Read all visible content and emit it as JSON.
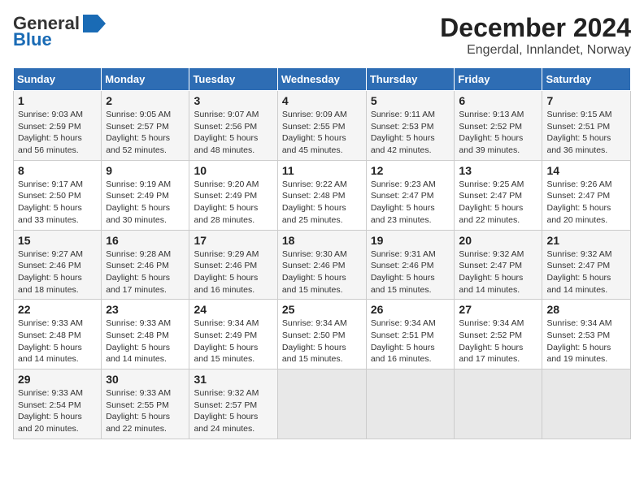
{
  "header": {
    "logo_line1": "General",
    "logo_line2": "Blue",
    "title": "December 2024",
    "subtitle": "Engerdal, Innlandet, Norway"
  },
  "calendar": {
    "weekdays": [
      "Sunday",
      "Monday",
      "Tuesday",
      "Wednesday",
      "Thursday",
      "Friday",
      "Saturday"
    ],
    "weeks": [
      [
        {
          "day": "1",
          "info": "Sunrise: 9:03 AM\nSunset: 2:59 PM\nDaylight: 5 hours\nand 56 minutes."
        },
        {
          "day": "2",
          "info": "Sunrise: 9:05 AM\nSunset: 2:57 PM\nDaylight: 5 hours\nand 52 minutes."
        },
        {
          "day": "3",
          "info": "Sunrise: 9:07 AM\nSunset: 2:56 PM\nDaylight: 5 hours\nand 48 minutes."
        },
        {
          "day": "4",
          "info": "Sunrise: 9:09 AM\nSunset: 2:55 PM\nDaylight: 5 hours\nand 45 minutes."
        },
        {
          "day": "5",
          "info": "Sunrise: 9:11 AM\nSunset: 2:53 PM\nDaylight: 5 hours\nand 42 minutes."
        },
        {
          "day": "6",
          "info": "Sunrise: 9:13 AM\nSunset: 2:52 PM\nDaylight: 5 hours\nand 39 minutes."
        },
        {
          "day": "7",
          "info": "Sunrise: 9:15 AM\nSunset: 2:51 PM\nDaylight: 5 hours\nand 36 minutes."
        }
      ],
      [
        {
          "day": "8",
          "info": "Sunrise: 9:17 AM\nSunset: 2:50 PM\nDaylight: 5 hours\nand 33 minutes."
        },
        {
          "day": "9",
          "info": "Sunrise: 9:19 AM\nSunset: 2:49 PM\nDaylight: 5 hours\nand 30 minutes."
        },
        {
          "day": "10",
          "info": "Sunrise: 9:20 AM\nSunset: 2:49 PM\nDaylight: 5 hours\nand 28 minutes."
        },
        {
          "day": "11",
          "info": "Sunrise: 9:22 AM\nSunset: 2:48 PM\nDaylight: 5 hours\nand 25 minutes."
        },
        {
          "day": "12",
          "info": "Sunrise: 9:23 AM\nSunset: 2:47 PM\nDaylight: 5 hours\nand 23 minutes."
        },
        {
          "day": "13",
          "info": "Sunrise: 9:25 AM\nSunset: 2:47 PM\nDaylight: 5 hours\nand 22 minutes."
        },
        {
          "day": "14",
          "info": "Sunrise: 9:26 AM\nSunset: 2:47 PM\nDaylight: 5 hours\nand 20 minutes."
        }
      ],
      [
        {
          "day": "15",
          "info": "Sunrise: 9:27 AM\nSunset: 2:46 PM\nDaylight: 5 hours\nand 18 minutes."
        },
        {
          "day": "16",
          "info": "Sunrise: 9:28 AM\nSunset: 2:46 PM\nDaylight: 5 hours\nand 17 minutes."
        },
        {
          "day": "17",
          "info": "Sunrise: 9:29 AM\nSunset: 2:46 PM\nDaylight: 5 hours\nand 16 minutes."
        },
        {
          "day": "18",
          "info": "Sunrise: 9:30 AM\nSunset: 2:46 PM\nDaylight: 5 hours\nand 15 minutes."
        },
        {
          "day": "19",
          "info": "Sunrise: 9:31 AM\nSunset: 2:46 PM\nDaylight: 5 hours\nand 15 minutes."
        },
        {
          "day": "20",
          "info": "Sunrise: 9:32 AM\nSunset: 2:47 PM\nDaylight: 5 hours\nand 14 minutes."
        },
        {
          "day": "21",
          "info": "Sunrise: 9:32 AM\nSunset: 2:47 PM\nDaylight: 5 hours\nand 14 minutes."
        }
      ],
      [
        {
          "day": "22",
          "info": "Sunrise: 9:33 AM\nSunset: 2:48 PM\nDaylight: 5 hours\nand 14 minutes."
        },
        {
          "day": "23",
          "info": "Sunrise: 9:33 AM\nSunset: 2:48 PM\nDaylight: 5 hours\nand 14 minutes."
        },
        {
          "day": "24",
          "info": "Sunrise: 9:34 AM\nSunset: 2:49 PM\nDaylight: 5 hours\nand 15 minutes."
        },
        {
          "day": "25",
          "info": "Sunrise: 9:34 AM\nSunset: 2:50 PM\nDaylight: 5 hours\nand 15 minutes."
        },
        {
          "day": "26",
          "info": "Sunrise: 9:34 AM\nSunset: 2:51 PM\nDaylight: 5 hours\nand 16 minutes."
        },
        {
          "day": "27",
          "info": "Sunrise: 9:34 AM\nSunset: 2:52 PM\nDaylight: 5 hours\nand 17 minutes."
        },
        {
          "day": "28",
          "info": "Sunrise: 9:34 AM\nSunset: 2:53 PM\nDaylight: 5 hours\nand 19 minutes."
        }
      ],
      [
        {
          "day": "29",
          "info": "Sunrise: 9:33 AM\nSunset: 2:54 PM\nDaylight: 5 hours\nand 20 minutes."
        },
        {
          "day": "30",
          "info": "Sunrise: 9:33 AM\nSunset: 2:55 PM\nDaylight: 5 hours\nand 22 minutes."
        },
        {
          "day": "31",
          "info": "Sunrise: 9:32 AM\nSunset: 2:57 PM\nDaylight: 5 hours\nand 24 minutes."
        },
        {
          "day": "",
          "info": ""
        },
        {
          "day": "",
          "info": ""
        },
        {
          "day": "",
          "info": ""
        },
        {
          "day": "",
          "info": ""
        }
      ]
    ]
  }
}
